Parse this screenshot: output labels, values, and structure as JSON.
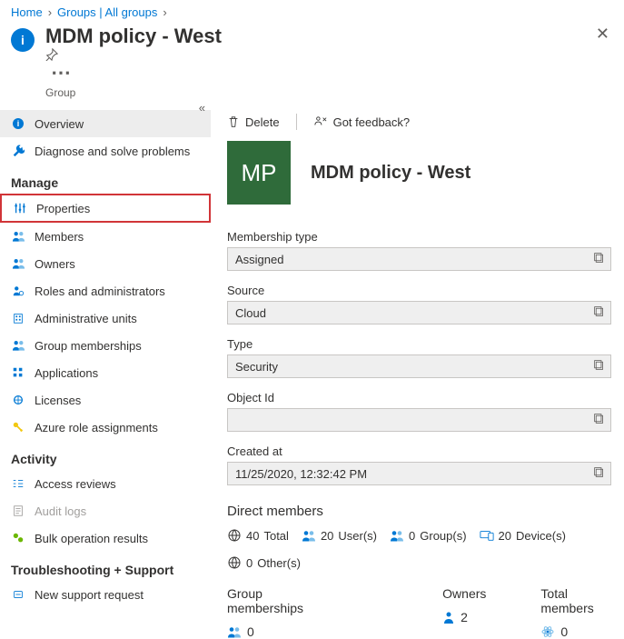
{
  "breadcrumb": {
    "home": "Home",
    "groups": "Groups | All groups"
  },
  "header": {
    "title": "MDM policy - West",
    "subtitle": "Group"
  },
  "sidebar": {
    "overview": "Overview",
    "diagnose": "Diagnose and solve problems",
    "manage_hdr": "Manage",
    "properties": "Properties",
    "members": "Members",
    "owners": "Owners",
    "roles": "Roles and administrators",
    "admin_units": "Administrative units",
    "group_memberships": "Group memberships",
    "applications": "Applications",
    "licenses": "Licenses",
    "azure_role": "Azure role assignments",
    "activity_hdr": "Activity",
    "access_reviews": "Access reviews",
    "audit_logs": "Audit logs",
    "bulk_results": "Bulk operation results",
    "trouble_hdr": "Troubleshooting + Support",
    "support": "New support request"
  },
  "toolbar": {
    "delete": "Delete",
    "feedback": "Got feedback?"
  },
  "hero": {
    "initials": "MP",
    "title": "MDM policy - West"
  },
  "fields": {
    "membership_type_label": "Membership type",
    "membership_type_value": "Assigned",
    "source_label": "Source",
    "source_value": "Cloud",
    "type_label": "Type",
    "type_value": "Security",
    "object_id_label": "Object Id",
    "object_id_value": "",
    "created_at_label": "Created at",
    "created_at_value": "11/25/2020, 12:32:42 PM"
  },
  "direct_members": {
    "title": "Direct members",
    "total_n": "40",
    "total_l": "Total",
    "users_n": "20",
    "users_l": "User(s)",
    "groups_n": "0",
    "groups_l": "Group(s)",
    "devices_n": "20",
    "devices_l": "Device(s)",
    "others_n": "0",
    "others_l": "Other(s)"
  },
  "summary": {
    "group_memberships_l": "Group memberships",
    "group_memberships_v": "0",
    "owners_l": "Owners",
    "owners_v": "2",
    "total_members_l": "Total members",
    "total_members_v": "0"
  }
}
